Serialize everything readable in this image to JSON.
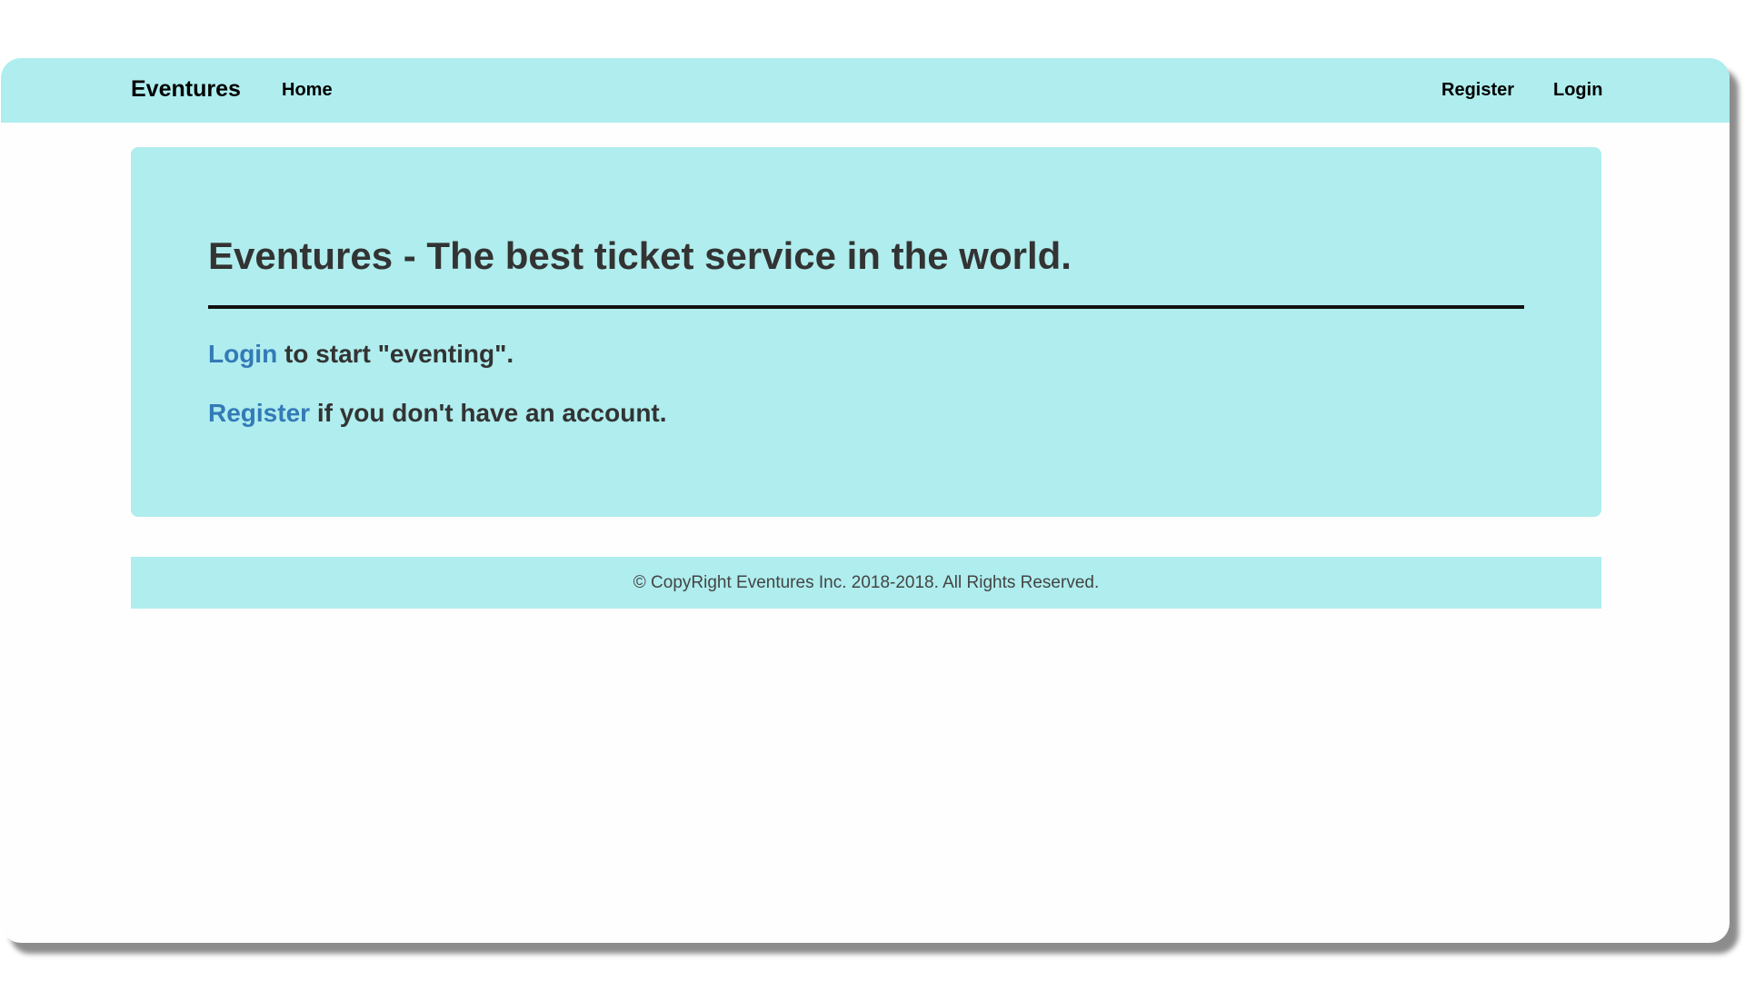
{
  "navbar": {
    "brand": "Eventures",
    "home_label": "Home",
    "register_label": "Register",
    "login_label": "Login"
  },
  "hero": {
    "title": "Eventures - The best ticket service in the world.",
    "login_link": "Login",
    "login_suffix": " to start \"eventing\".",
    "register_link": "Register",
    "register_suffix": " if you don't have an account."
  },
  "footer": {
    "text": "© CopyRight Eventures Inc. 2018-2018. All Rights Reserved."
  },
  "colors": {
    "accent_bg": "#afedee",
    "link": "#337ab7",
    "text": "#333333"
  }
}
